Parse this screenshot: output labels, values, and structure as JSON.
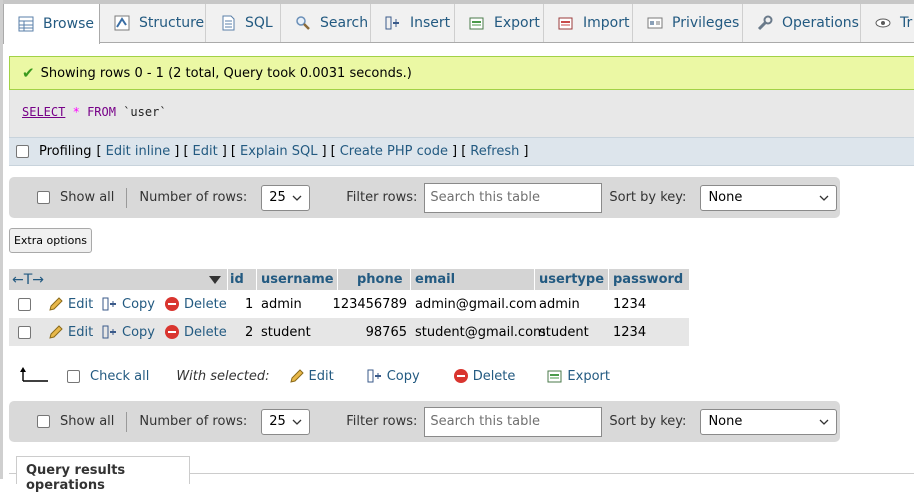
{
  "tabs": [
    {
      "label": "Browse",
      "icon": "browse-icon",
      "active": true
    },
    {
      "label": "Structure",
      "icon": "structure-icon"
    },
    {
      "label": "SQL",
      "icon": "sql-icon"
    },
    {
      "label": "Search",
      "icon": "search-icon"
    },
    {
      "label": "Insert",
      "icon": "insert-icon"
    },
    {
      "label": "Export",
      "icon": "export-icon"
    },
    {
      "label": "Import",
      "icon": "import-icon"
    },
    {
      "label": "Privileges",
      "icon": "privileges-icon"
    },
    {
      "label": "Operations",
      "icon": "operations-icon"
    },
    {
      "label": "Tr",
      "icon": "tracking-icon"
    }
  ],
  "message": {
    "text": "Showing rows 0 - 1 (2 total, Query took 0.0031 seconds.)",
    "icon": "checkmark-icon",
    "bg_color": "#ebf8a4"
  },
  "query": {
    "select_kw": "SELECT",
    "star": "*",
    "from_kw": "FROM",
    "table": "`user`"
  },
  "profiling": {
    "label": "Profiling",
    "open1": "[",
    "edit_inline": "Edit inline",
    "mid1": "] [",
    "edit": "Edit",
    "mid2": "] [",
    "explain": "Explain SQL",
    "mid3": "] [",
    "php": "Create PHP code",
    "mid4": "] [",
    "refresh": "Refresh",
    "close": "]"
  },
  "nav": {
    "show_all": "Show all",
    "num_rows_label": "Number of rows:",
    "num_rows_value": "25",
    "filter_label": "Filter rows:",
    "filter_placeholder": "Search this table",
    "sort_label": "Sort by key:",
    "sort_value": "None"
  },
  "extra_options": "Extra options",
  "table": {
    "columns": [
      "id",
      "username",
      "phone",
      "email",
      "usertype",
      "password"
    ],
    "arrows": "←T→",
    "actions": {
      "edit": "Edit",
      "copy": "Copy",
      "delete": "Delete"
    },
    "rows": [
      [
        "1",
        "admin",
        "123456789",
        "admin@gmail.com",
        "admin",
        "1234"
      ],
      [
        "2",
        "student",
        "98765",
        "student@gmail.com",
        "student",
        "1234"
      ]
    ]
  },
  "bulk": {
    "check_all": "Check all",
    "with_selected": "With selected:",
    "edit": "Edit",
    "copy": "Copy",
    "delete": "Delete",
    "export": "Export"
  },
  "qro_title": "Query results operations",
  "colors": {
    "link": "#235a81",
    "accent_green": "#a2d246",
    "delete_red": "#d9352f"
  }
}
